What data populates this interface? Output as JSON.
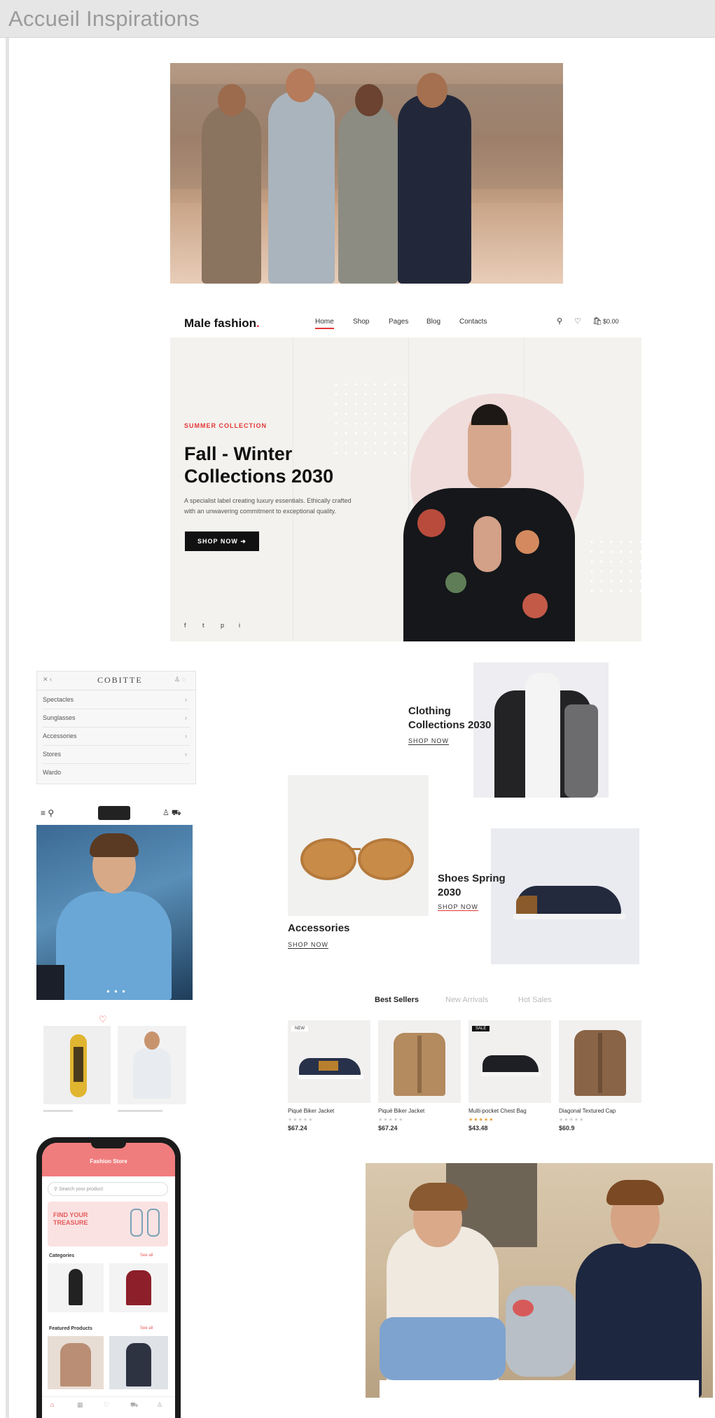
{
  "page": {
    "title": "Accueil Inspirations"
  },
  "site": {
    "logo": "Male fashion",
    "logo_dot": ".",
    "nav": [
      "Home",
      "Shop",
      "Pages",
      "Blog",
      "Contacts"
    ],
    "cart_total": "$0.00",
    "hero": {
      "eyebrow": "SUMMER COLLECTION",
      "title_line1": "Fall - Winter",
      "title_line2": "Collections 2030",
      "description": "A specialist label creating luxury essentials. Ethically crafted with an unwavering commitment to exceptional quality.",
      "button": "SHOP NOW",
      "social_icons": [
        "f",
        "t",
        "p",
        "i"
      ]
    }
  },
  "menu_card": {
    "brand": "COBITTE",
    "items": [
      "Spectacles",
      "Sunglasses",
      "Accessories",
      "Stores",
      "Wardo"
    ]
  },
  "categories": [
    {
      "title_line1": "Clothing",
      "title_line2": "Collections 2030",
      "link": "SHOP NOW"
    },
    {
      "title_line1": "Accessories",
      "title_line2": "",
      "link": "SHOP NOW"
    },
    {
      "title_line1": "Shoes Spring",
      "title_line2": "2030",
      "link": "SHOP NOW"
    }
  ],
  "tabs": [
    "Best Sellers",
    "New Arrivals",
    "Hot Sales"
  ],
  "products": [
    {
      "name": "Piqué Biker Jacket",
      "stars": "★★★★★",
      "price": "$67.24",
      "badge": "NEW",
      "badge_dark": false
    },
    {
      "name": "Piqué Biker Jacket",
      "stars": "★★★★★",
      "price": "$67.24",
      "badge": "",
      "badge_dark": false
    },
    {
      "name": "Multi-pocket Chest Bag",
      "stars": "★★★★★",
      "price": "$43.48",
      "badge": "SALE",
      "badge_dark": true
    },
    {
      "name": "Diagonal Textured Cap",
      "stars": "★★★★★",
      "price": "$60.9",
      "badge": "",
      "badge_dark": false
    }
  ],
  "phone": {
    "header": "Fashion Store",
    "search_placeholder": "Search your product",
    "promo_line1": "FIND YOUR",
    "promo_line2": "TREASURE",
    "categories_label": "Categories",
    "featured_label": "Featured Products",
    "see_all": "See all"
  },
  "colors": {
    "accent": "#e53637",
    "phone_accent": "#f07d7d",
    "hero_bg": "#f3f2ee",
    "topbar": "#e6e6e6"
  }
}
